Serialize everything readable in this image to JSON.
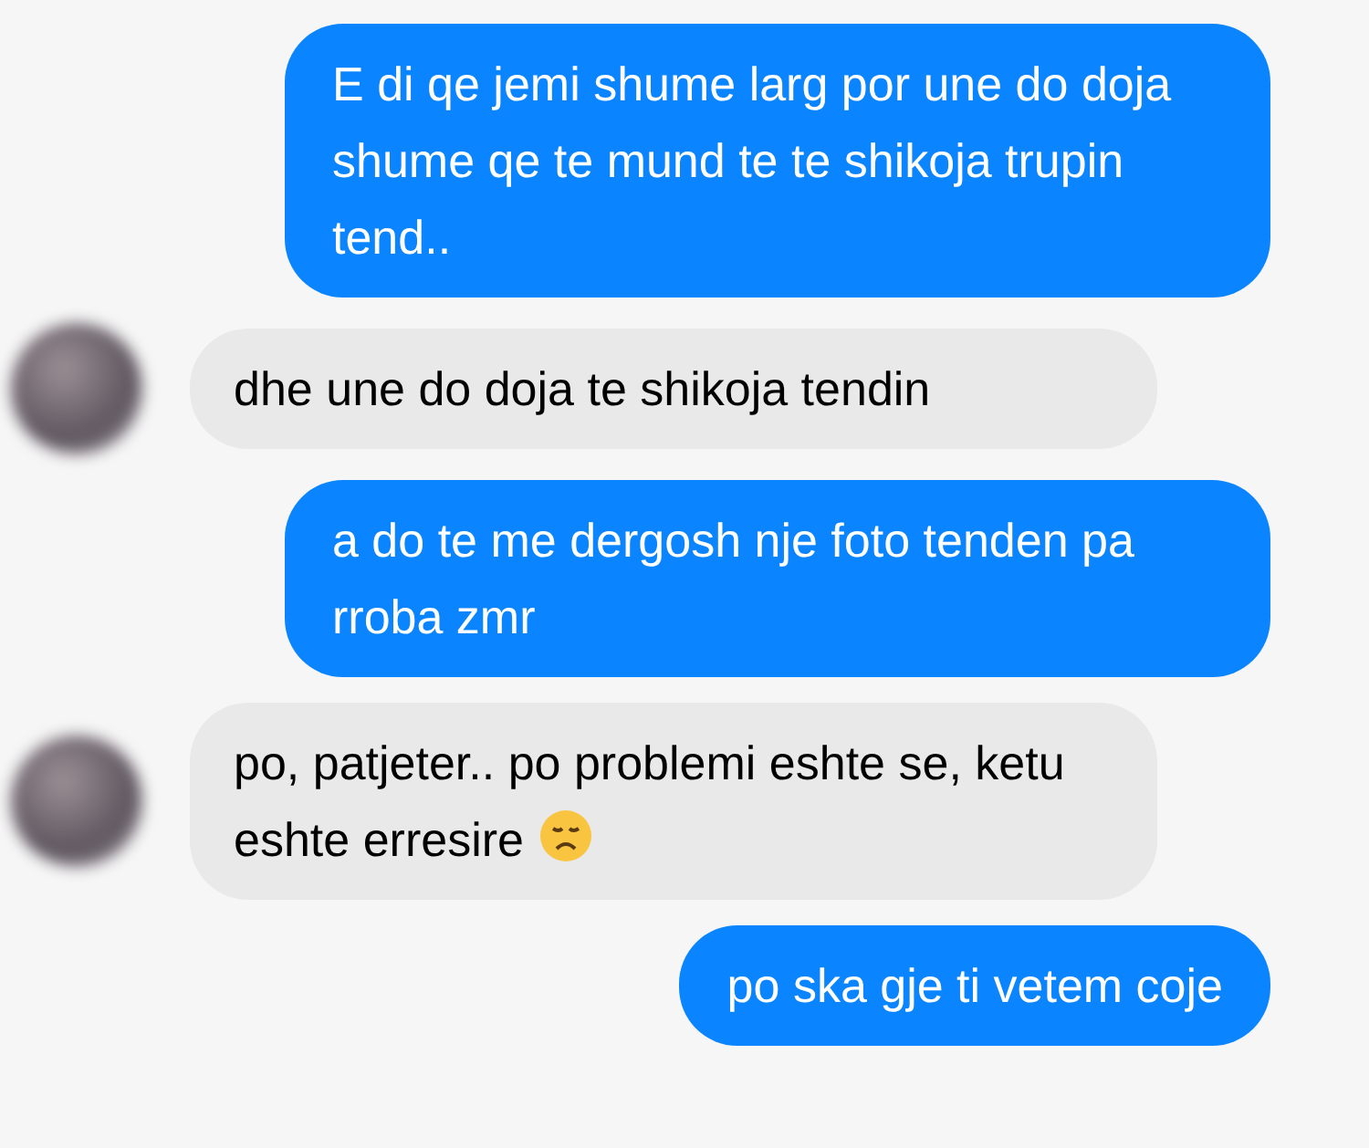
{
  "messages": [
    {
      "kind": "outgoing",
      "text": "E di qe jemi shume larg por une do doja shume qe te mund te te shikoja trupin tend.."
    },
    {
      "kind": "incoming",
      "text": "dhe une do doja te shikoja tendin"
    },
    {
      "kind": "outgoing",
      "text": "a do te me dergosh nje foto tenden pa rroba zmr"
    },
    {
      "kind": "incoming",
      "text": "po, patjeter.. po problemi eshte se, ketu eshte erresire",
      "sad_face": true
    },
    {
      "kind": "outgoing",
      "text": "po ska gje ti vetem coje"
    }
  ]
}
